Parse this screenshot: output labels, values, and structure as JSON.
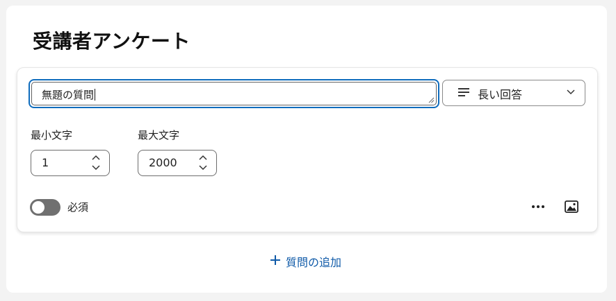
{
  "survey": {
    "title": "受講者アンケート"
  },
  "question": {
    "text": "無題の質問",
    "type_label": "長い回答",
    "min_label": "最小文字",
    "min_value": "1",
    "max_label": "最大文字",
    "max_value": "2000",
    "required_label": "必須",
    "required": false
  },
  "actions": {
    "add_question": "質問の追加"
  },
  "colors": {
    "accent": "#0f6cbd",
    "link": "#0f5aa8",
    "toggle_off": "#707070"
  },
  "icons": [
    "text-lines-icon",
    "chevron-down-icon",
    "chevron-up-icon",
    "more-icon",
    "image-icon",
    "plus-icon",
    "resize-grip-icon"
  ]
}
